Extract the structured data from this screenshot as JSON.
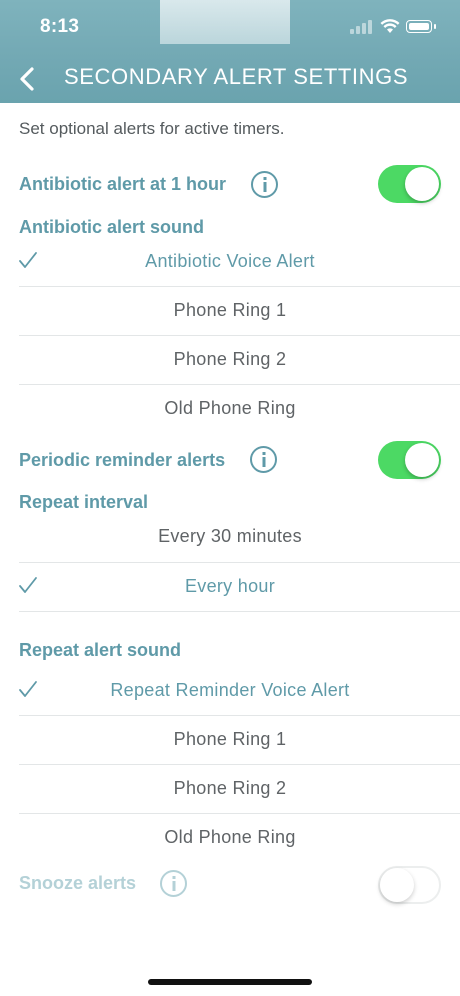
{
  "status_bar": {
    "time": "8:13"
  },
  "header": {
    "title": "SECONDARY ALERT SETTINGS"
  },
  "subtitle": "Set optional alerts for active timers.",
  "antibiotic": {
    "toggle_label": "Antibiotic alert at 1 hour",
    "toggle_on": true,
    "sound_label": "Antibiotic alert sound",
    "options": [
      {
        "label": "Antibiotic Voice Alert",
        "selected": true
      },
      {
        "label": "Phone Ring 1",
        "selected": false
      },
      {
        "label": "Phone Ring 2",
        "selected": false
      },
      {
        "label": "Old Phone Ring",
        "selected": false
      }
    ]
  },
  "periodic": {
    "toggle_label": "Periodic reminder alerts",
    "toggle_on": true,
    "interval_label": "Repeat interval",
    "intervals": [
      {
        "label": "Every 30 minutes",
        "selected": false
      },
      {
        "label": "Every hour",
        "selected": true
      }
    ],
    "sound_label": "Repeat alert sound",
    "sounds": [
      {
        "label": "Repeat Reminder Voice Alert",
        "selected": true
      },
      {
        "label": "Phone Ring 1",
        "selected": false
      },
      {
        "label": "Phone Ring 2",
        "selected": false
      },
      {
        "label": "Old Phone Ring",
        "selected": false
      }
    ]
  },
  "snooze": {
    "toggle_label": "Snooze alerts",
    "toggle_on": false
  },
  "colors": {
    "accent": "#5f9aa8",
    "accent_disabled": "#b4d1d7",
    "toggle_on": "#4cd964",
    "header_bg": "#73a9b4",
    "text": "#5f6366"
  }
}
